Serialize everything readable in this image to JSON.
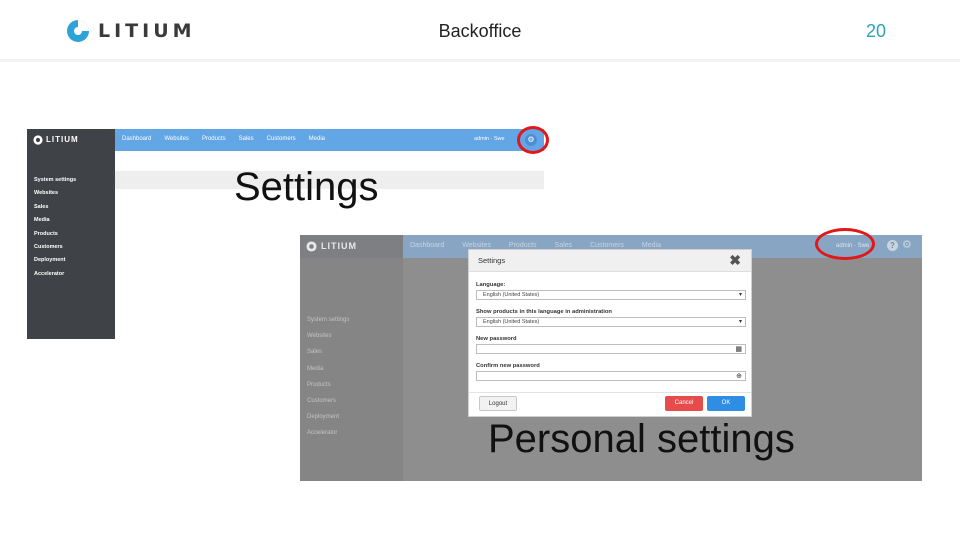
{
  "slide": {
    "brand": "LITIUM",
    "title": "Backoffice",
    "page_number": "20",
    "accent_color": "#2ea3b8",
    "highlight_color": "#e01818"
  },
  "screenshot_settings": {
    "logo": "LITIUM",
    "nav": [
      "Dashboard",
      "Websites",
      "Products",
      "Sales",
      "Customers",
      "Media"
    ],
    "user_area": "admin · Swe",
    "gear_icon": "gear-icon",
    "sidebar": [
      "System settings",
      "Websites",
      "Sales",
      "Media",
      "Products",
      "Customers",
      "Deployment",
      "Accelerator"
    ],
    "caption": "Settings"
  },
  "screenshot_personal": {
    "logo": "LITIUM",
    "nav": [
      "Dashboard",
      "Websites",
      "Products",
      "Sales",
      "Customers",
      "Media"
    ],
    "user_area": "admin · Swe",
    "sidebar": [
      "System settings",
      "Websites",
      "Sales",
      "Media",
      "Products",
      "Customers",
      "Deployment",
      "Accelerator"
    ],
    "dialog": {
      "title": "Settings",
      "close_icon": "close-icon",
      "language_label": "Language:",
      "language_value": "English (United States)",
      "show_products_label": "Show products in this language in administration",
      "show_products_value": "English (United States)",
      "new_password_label": "New password",
      "new_password_value": "",
      "confirm_password_label": "Confirm new password",
      "confirm_password_value": "",
      "logout_label": "Logout",
      "cancel_label": "Cancel",
      "ok_label": "OK"
    },
    "caption": "Personal settings"
  }
}
